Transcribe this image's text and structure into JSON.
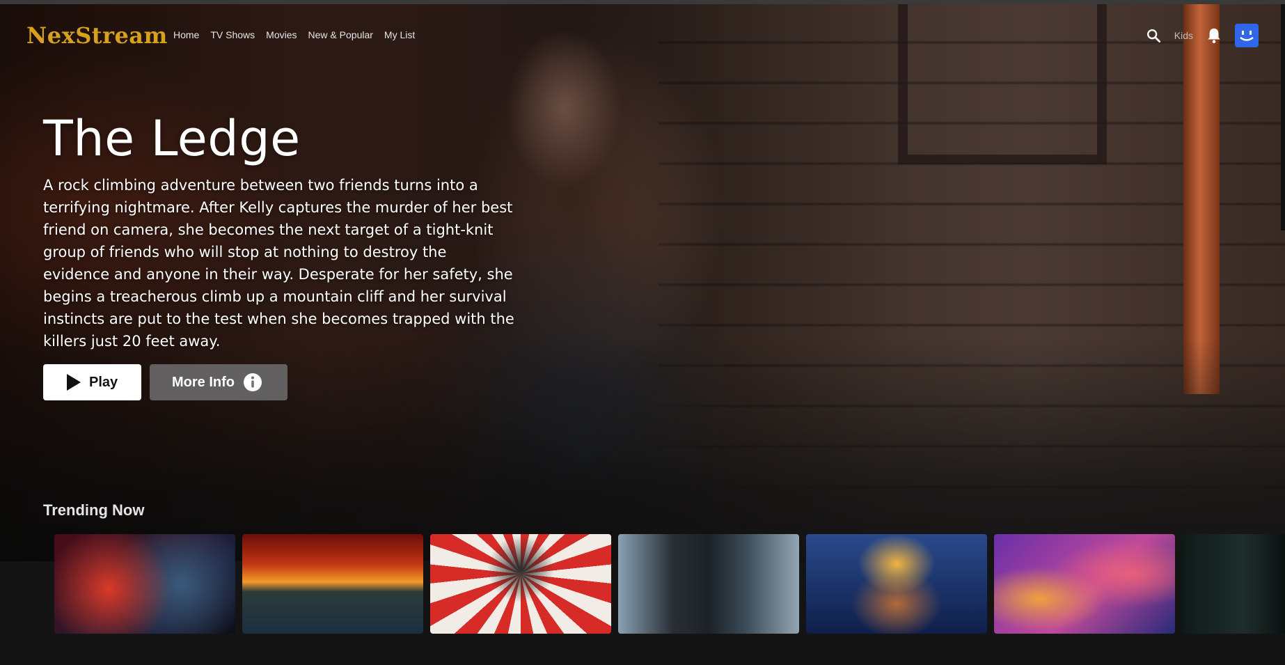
{
  "app": {
    "brand": "NexStream"
  },
  "nav": {
    "links": [
      "Home",
      "TV Shows",
      "Movies",
      "New & Popular",
      "My List"
    ],
    "kids_label": "Kids",
    "icons": {
      "search": "search-icon",
      "notifications": "bell-icon",
      "profile": "avatar"
    }
  },
  "hero": {
    "title": "The Ledge",
    "description": "A rock climbing adventure between two friends turns into a terrifying nightmare. After Kelly captures the murder of her best friend on camera, she becomes the next target of a tight-knit group of friends who will stop at nothing to destroy the evidence and anyone in their way. Desperate for her safety, she begins a treacherous climb up a mountain cliff and her survival instincts are put to the test when she becomes trapped with the killers just 20 feet away.",
    "play_label": "Play",
    "info_label": "More Info"
  },
  "rows": [
    {
      "title": "Trending Now",
      "item_count": 7
    }
  ],
  "colors": {
    "brand": "#d6a21e",
    "background": "#141414",
    "avatar": "#2f67e8"
  }
}
